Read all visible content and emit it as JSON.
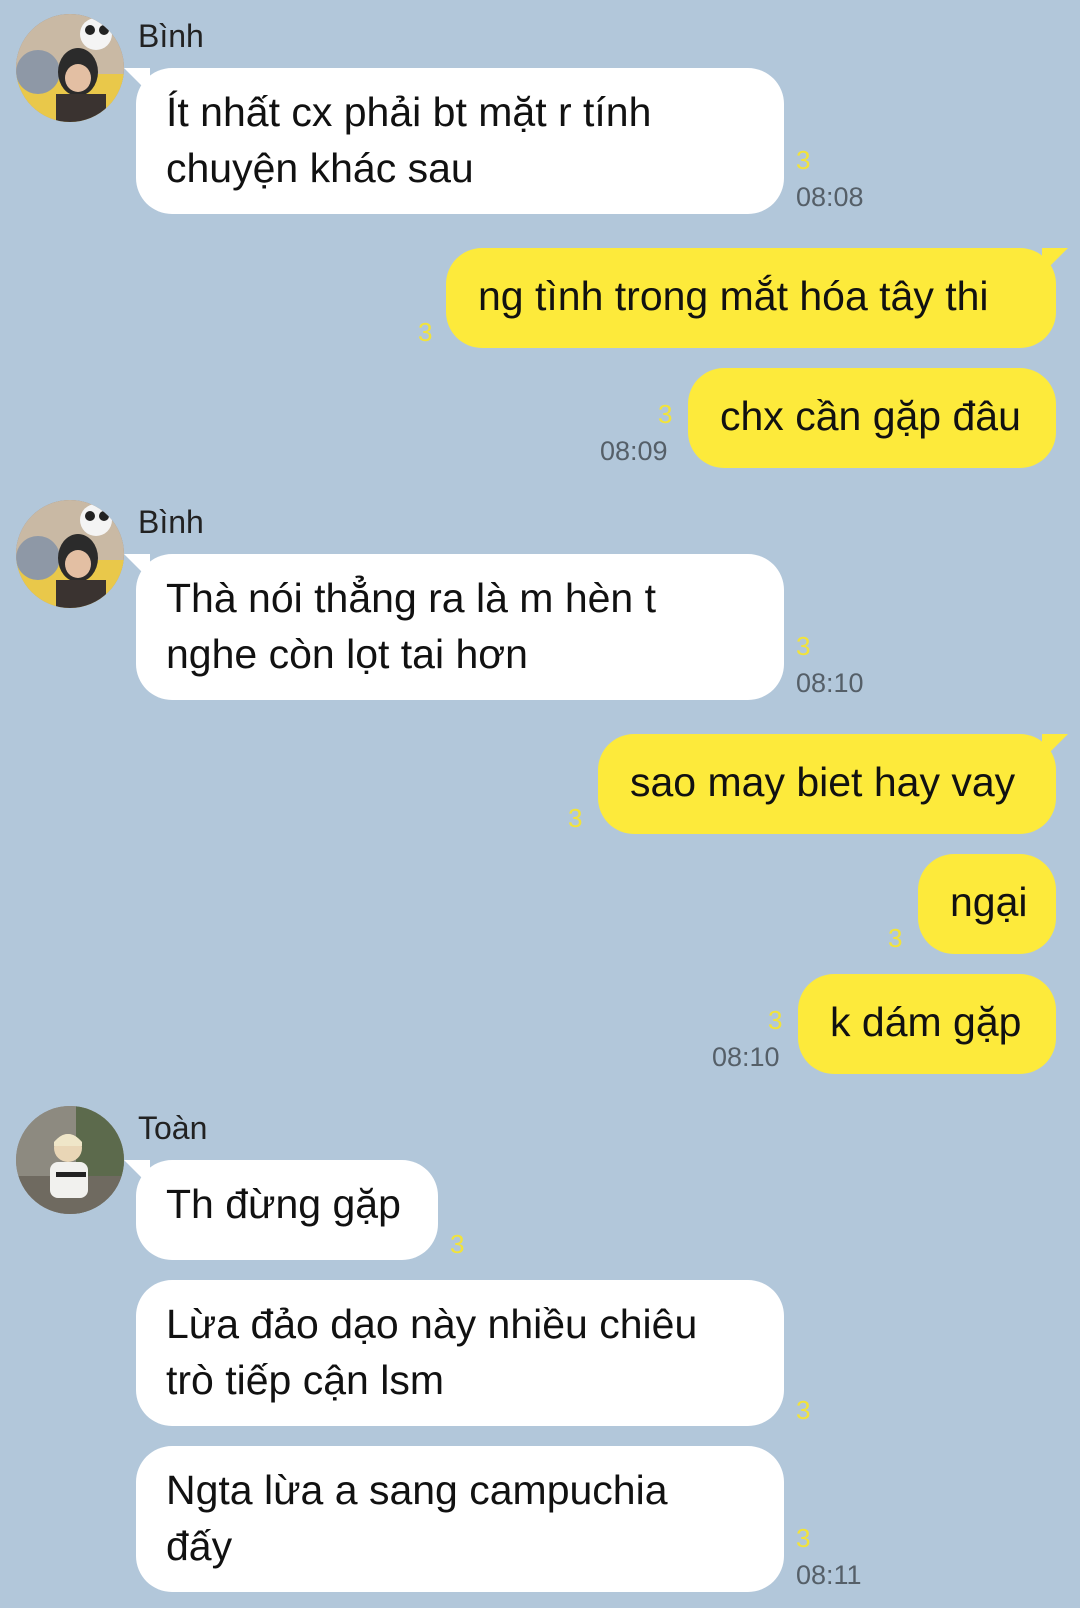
{
  "conversation": {
    "senders": {
      "binh": "Bình",
      "toan": "Toàn"
    },
    "messages": [
      {
        "from": "Bình",
        "text": "Ít nhất cx phải bt mặt r tính\nchuyện khác sau",
        "read": "3",
        "time": "08:08"
      },
      {
        "from": "me",
        "text": "ng tình trong mắt hóa tây thi",
        "read": "3",
        "time": ""
      },
      {
        "from": "me",
        "text": "chx cần gặp đâu",
        "read": "3",
        "time": "08:09"
      },
      {
        "from": "Bình",
        "text": "Thà nói thẳng ra là m hèn t\nnghe còn lọt tai hơn",
        "read": "3",
        "time": "08:10"
      },
      {
        "from": "me",
        "text": "sao may biet hay vay",
        "read": "3",
        "time": ""
      },
      {
        "from": "me",
        "text": "ngại",
        "read": "3",
        "time": ""
      },
      {
        "from": "me",
        "text": "k dám gặp",
        "read": "3",
        "time": "08:10"
      },
      {
        "from": "Toàn",
        "text": "Th đừng gặp",
        "read": "3",
        "time": ""
      },
      {
        "from": "Toàn",
        "text": "Lừa đảo dạo này nhiều chiêu\ntrò tiếp cận lsm",
        "read": "3",
        "time": ""
      },
      {
        "from": "Toàn",
        "text": "Ngta lừa a sang campuchia\nđấy",
        "read": "3",
        "time": "08:11"
      }
    ]
  },
  "colors": {
    "background": "#b2c7da",
    "incoming_bubble": "#ffffff",
    "outgoing_bubble": "#fdea3b",
    "read_count": "#f2e33a",
    "time": "#555f68"
  }
}
